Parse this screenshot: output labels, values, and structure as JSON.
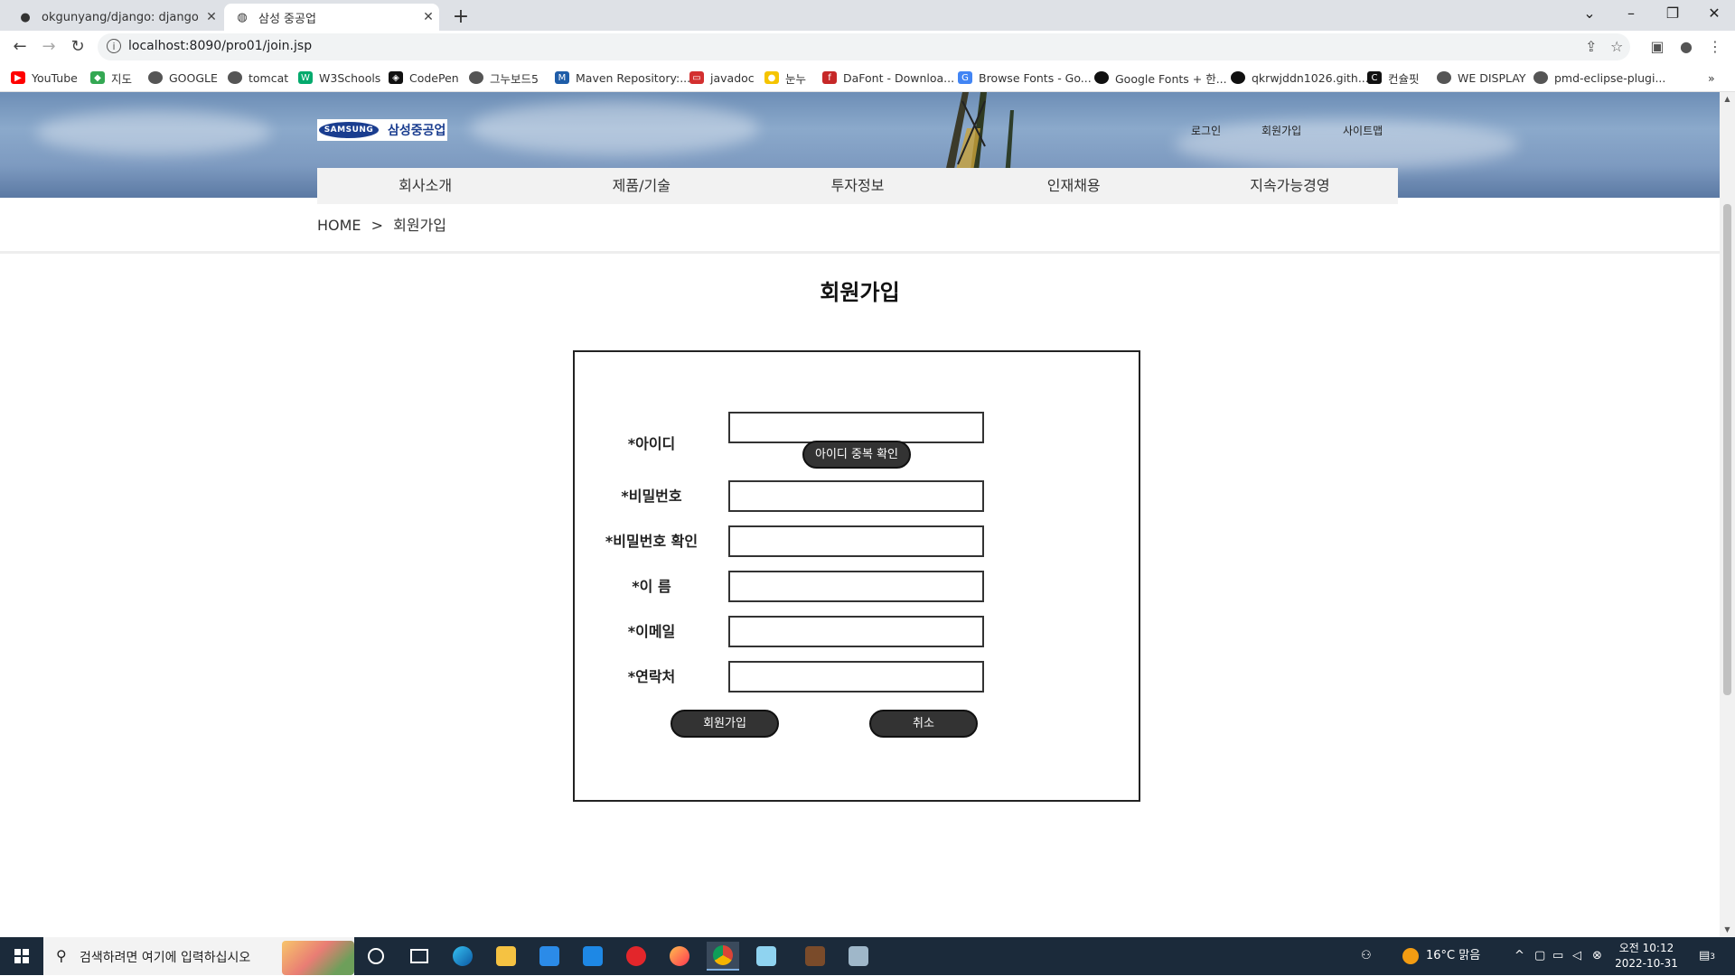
{
  "browser": {
    "tabs": [
      {
        "title": "okgunyang/django: django boo",
        "icon": "github-icon"
      },
      {
        "title": "삼성 중공업",
        "icon": "globe-icon"
      }
    ],
    "address": "localhost:8090/pro01/join.jsp",
    "bookmarks": [
      {
        "label": "YouTube",
        "icon": "youtube-icon",
        "color": "#ff0000"
      },
      {
        "label": "지도",
        "icon": "maps-icon",
        "color": "#34a853"
      },
      {
        "label": "GOOGLE",
        "icon": "globe-icon",
        "color": "#555555"
      },
      {
        "label": "tomcat",
        "icon": "globe-icon",
        "color": "#555555"
      },
      {
        "label": "W3Schools",
        "icon": "w3schools-icon",
        "color": "#04aa6d"
      },
      {
        "label": "CodePen",
        "icon": "codepen-icon",
        "color": "#111111"
      },
      {
        "label": "그누보드5",
        "icon": "globe-icon",
        "color": "#555555"
      },
      {
        "label": "Maven Repository:...",
        "icon": "maven-icon",
        "color": "#1f5da8"
      },
      {
        "label": "javadoc",
        "icon": "javadoc-icon",
        "color": "#d32f2f"
      },
      {
        "label": "눈누",
        "icon": "noonnu-icon",
        "color": "#f5c400"
      },
      {
        "label": "DaFont - Downloa...",
        "icon": "dafont-icon",
        "color": "#c62828"
      },
      {
        "label": "Browse Fonts - Go...",
        "icon": "googlefonts-icon",
        "color": "#4285f4"
      },
      {
        "label": "Google Fonts + 한...",
        "icon": "font-icon",
        "color": "#111111"
      },
      {
        "label": "qkrwjddn1026.gith...",
        "icon": "github-icon",
        "color": "#111111"
      },
      {
        "label": "컨슐핏",
        "icon": "consulfit-icon",
        "color": "#111111"
      },
      {
        "label": "WE DISPLAY",
        "icon": "globe-icon",
        "color": "#555555"
      },
      {
        "label": "pmd-eclipse-plugi...",
        "icon": "globe-icon",
        "color": "#555555"
      }
    ]
  },
  "site": {
    "logo_en": "SAMSUNG",
    "logo_kr": "삼성중공업",
    "util": [
      "로그인",
      "회원가입",
      "사이트맵"
    ],
    "gnb": [
      "회사소개",
      "제품/기술",
      "투자정보",
      "인재채용",
      "지속가능경영"
    ],
    "breadcrumb": {
      "home": "HOME",
      "sep": ">",
      "current": "회원가입"
    }
  },
  "form": {
    "title": "회원가입",
    "fields": [
      {
        "label": "*아이디",
        "value": ""
      },
      {
        "label": "*비밀번호",
        "value": ""
      },
      {
        "label": "*비밀번호 확인",
        "value": ""
      },
      {
        "label": "*이 름",
        "value": ""
      },
      {
        "label": "*이메일",
        "value": ""
      },
      {
        "label": "*연락처",
        "value": ""
      }
    ],
    "id_check_button": "아이디 중복 확인",
    "submit_button": "회원가입",
    "cancel_button": "취소"
  },
  "taskbar": {
    "search_placeholder": "검색하려면 여기에 입력하십시오",
    "weather": "16°C  맑음",
    "time": "오전 10:12",
    "date": "2022-10-31",
    "notification_count": "3"
  }
}
